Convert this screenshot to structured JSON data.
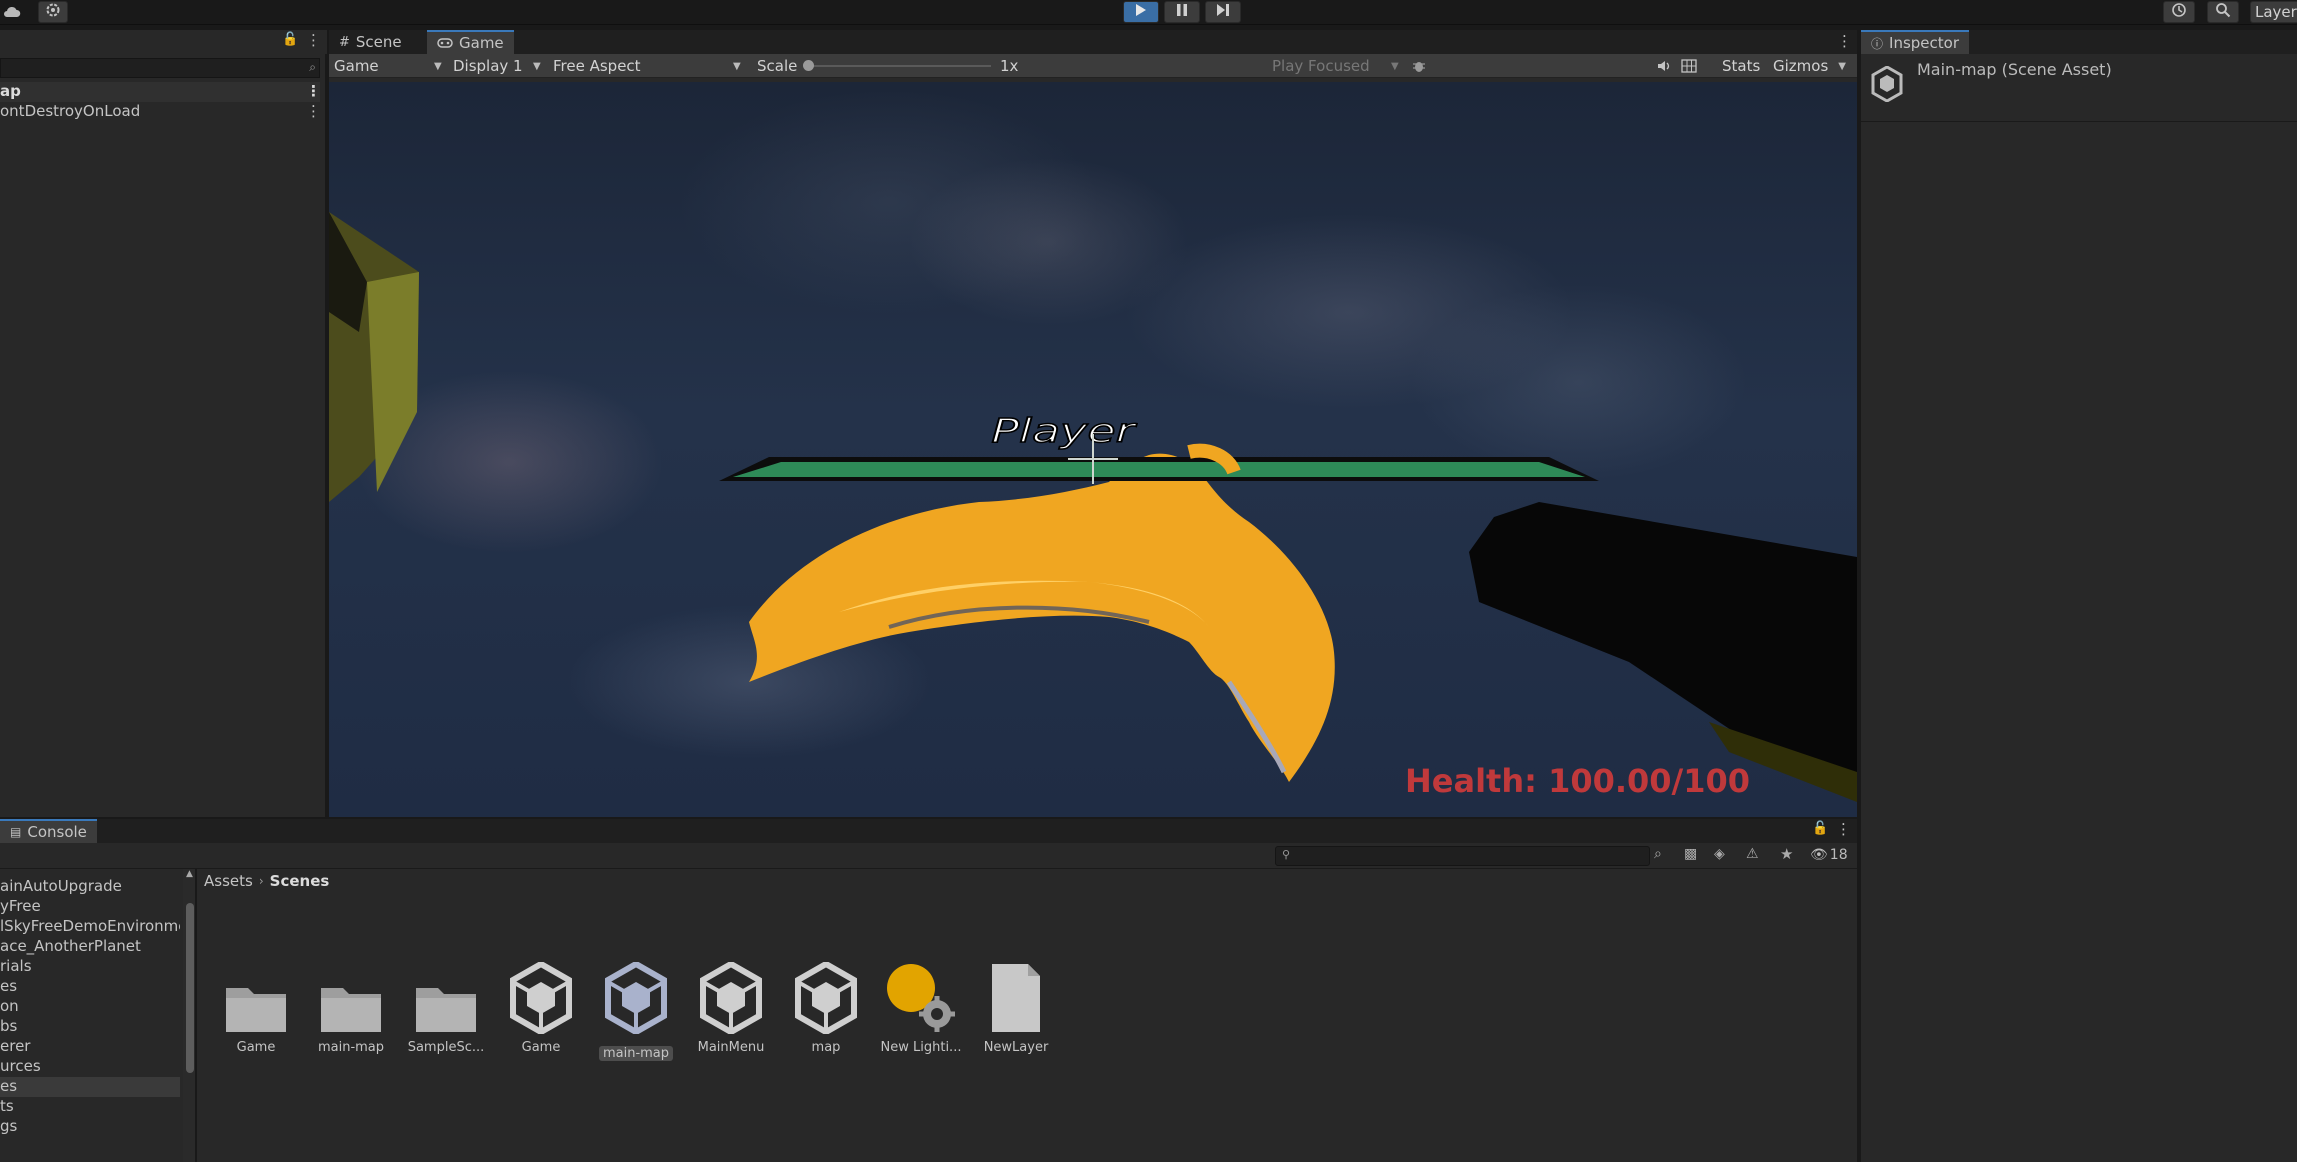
{
  "toolbar": {
    "cloud_icon": "cloud-icon",
    "settings_icon": "gear-icon",
    "play_icon": "play-icon",
    "pause_icon": "pause-icon",
    "step_icon": "step-icon",
    "history_icon": "history-icon",
    "search_icon": "search-icon",
    "layers_label": "Layers"
  },
  "hierarchy": {
    "rows": [
      "ap",
      "ontDestroyOnLoad"
    ]
  },
  "game_panel": {
    "tabs": [
      {
        "label": "Scene",
        "icon": "grid-icon"
      },
      {
        "label": "Game",
        "icon": "gamepad-icon"
      }
    ],
    "toolbar": {
      "view_mode": "Game",
      "display": "Display 1",
      "aspect": "Free Aspect",
      "scale_label": "Scale",
      "scale_value": "1x",
      "scale_fraction": 0.0,
      "play_mode": "Play Focused",
      "stats_label": "Stats",
      "gizmos_label": "Gizmos"
    },
    "hud": {
      "player_label": "Player",
      "health_text": "Health: 100.00/100",
      "health_fraction": 1.0,
      "health_color": "#c0393b",
      "bar_color": "#2e8a58"
    }
  },
  "inspector": {
    "tab_label": "Inspector",
    "title": "Main-map (Scene Asset)"
  },
  "console": {
    "tab_label": "Console",
    "badge_count": "18"
  },
  "project": {
    "breadcrumb": [
      "Assets",
      "Scenes"
    ],
    "folders": [
      "ainAutoUpgrade",
      "yFree",
      "lSkyFreeDemoEnvironme",
      "ace_AnotherPlanet",
      "rials",
      "es",
      "on",
      "bs",
      "erer",
      "urces",
      "es",
      "ts",
      "gs"
    ],
    "selected_folder_index": 10,
    "assets": [
      {
        "label": "Game",
        "kind": "folder"
      },
      {
        "label": "main-map",
        "kind": "folder"
      },
      {
        "label": "SampleSc...",
        "kind": "folder"
      },
      {
        "label": "Game",
        "kind": "scene"
      },
      {
        "label": "main-map",
        "kind": "scene",
        "selected": true
      },
      {
        "label": "MainMenu",
        "kind": "scene"
      },
      {
        "label": "map",
        "kind": "scene"
      },
      {
        "label": "New Lighti...",
        "kind": "lighting"
      },
      {
        "label": "NewLayer",
        "kind": "file"
      }
    ]
  }
}
